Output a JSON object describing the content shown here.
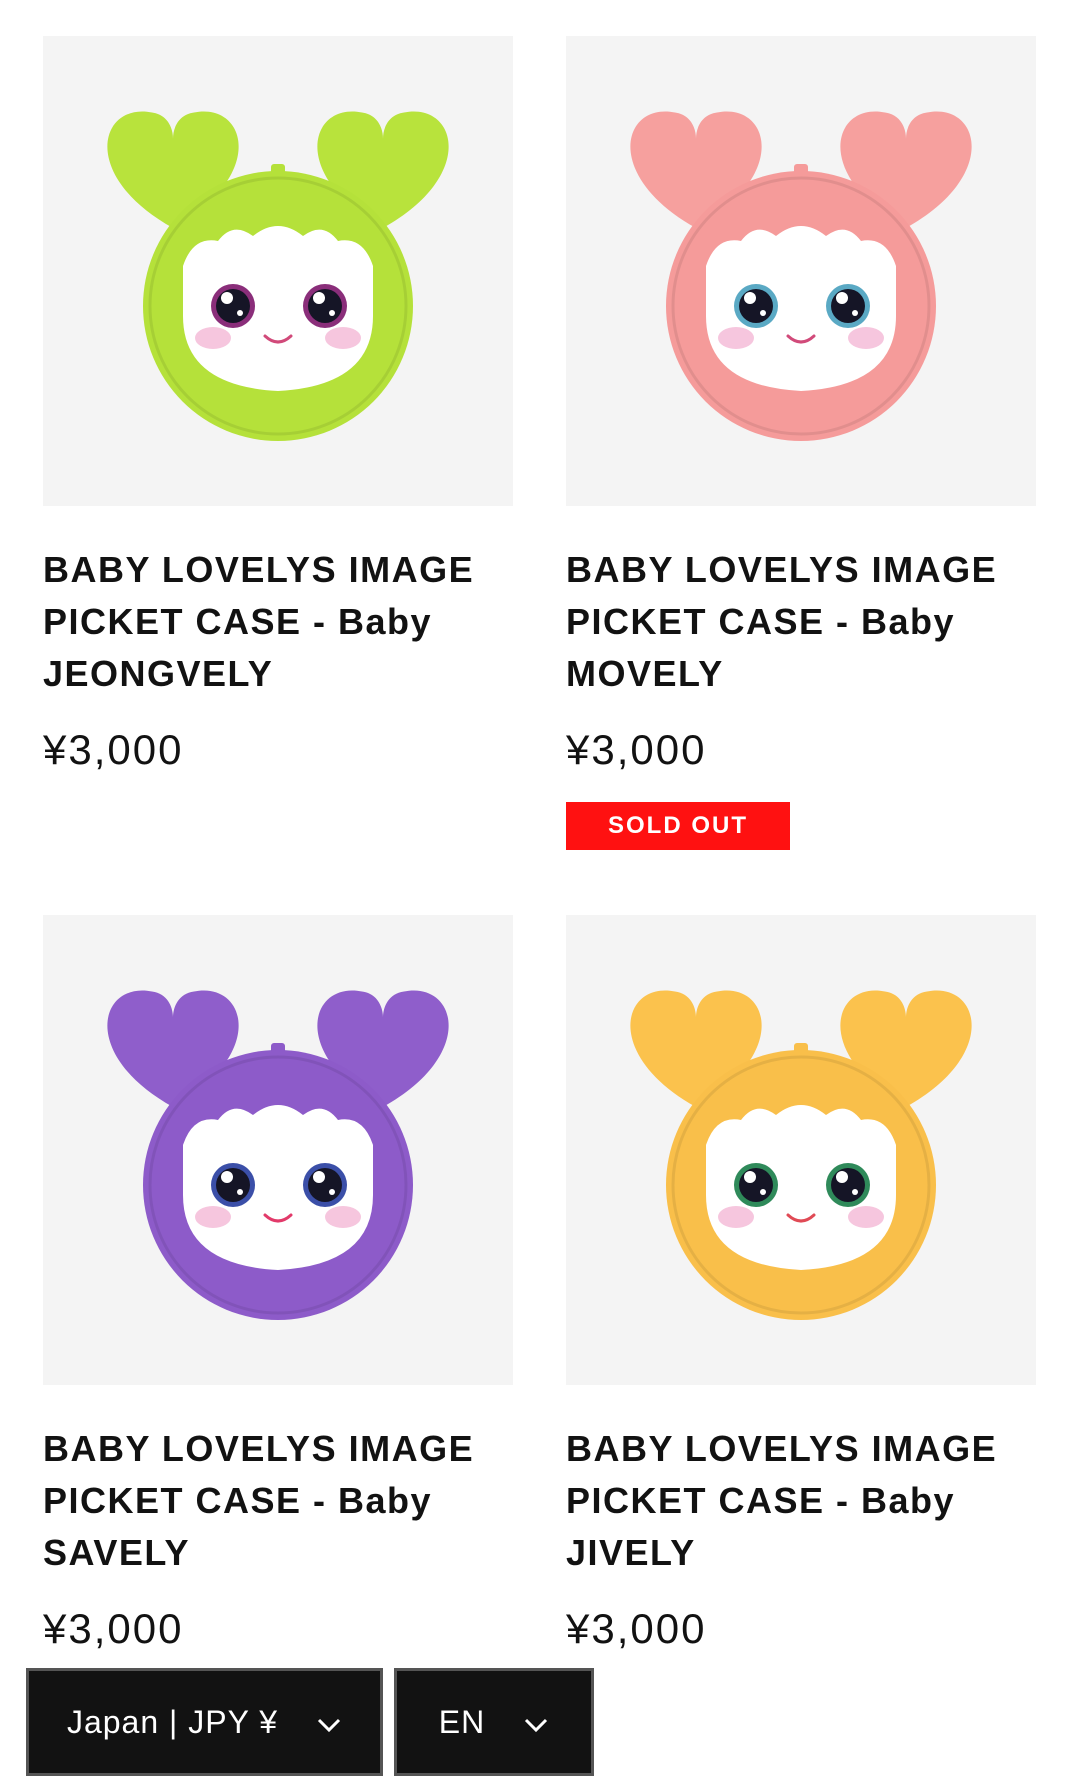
{
  "products": [
    {
      "title": "BABY LOVELYS IMAGE PICKET CASE - Baby JEONGVELY",
      "price": "¥3,000",
      "badge": "",
      "colors": {
        "main": "#b5e13a",
        "ear": "#b8e33c",
        "eye": "#8a2e7a",
        "mouth": "#d14a7a"
      }
    },
    {
      "title": "BABY LOVELYS IMAGE PICKET CASE - Baby MOVELY",
      "price": "¥3,000",
      "badge": "SOLD OUT",
      "colors": {
        "main": "#f59b9a",
        "ear": "#f6a09e",
        "eye": "#5aa9c4",
        "mouth": "#d14a7a"
      }
    },
    {
      "title": "BABY LOVELYS IMAGE PICKET CASE - Baby SAVELY",
      "price": "¥3,000",
      "badge": "",
      "colors": {
        "main": "#8d5bc9",
        "ear": "#8f5ecb",
        "eye": "#3b4fa8",
        "mouth": "#e23a6a"
      }
    },
    {
      "title": "BABY LOVELYS IMAGE PICKET CASE - Baby JIVELY",
      "price": "¥3,000",
      "badge": "",
      "colors": {
        "main": "#f9bf4a",
        "ear": "#fbc24d",
        "eye": "#2f8a5a",
        "mouth": "#e04a55"
      }
    }
  ],
  "footer": {
    "country_selector": "Japan | JPY ¥",
    "language_selector": "EN"
  },
  "icons": {
    "chevron": "chevron-down-icon"
  }
}
